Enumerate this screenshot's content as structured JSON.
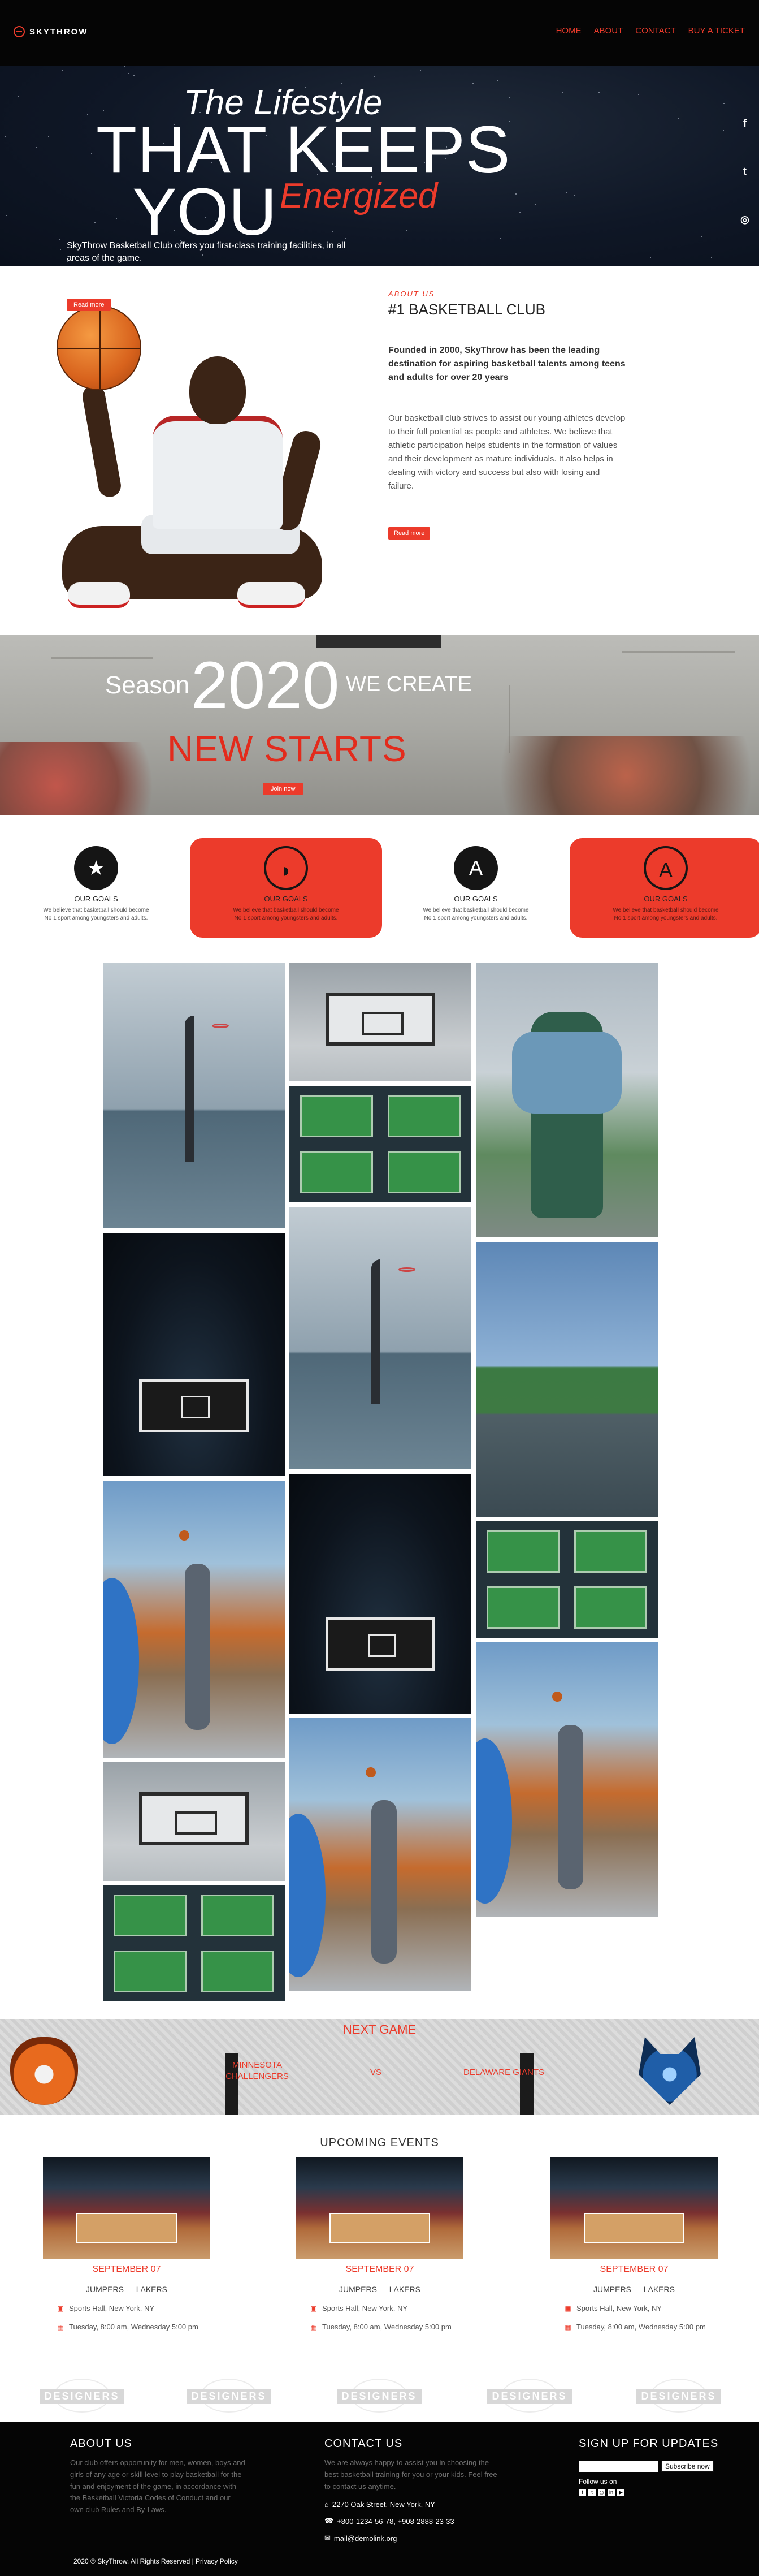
{
  "header": {
    "logo_text": "SKYTHROW",
    "nav": [
      "HOME",
      "ABOUT",
      "CONTACT",
      "BUY A TICKET"
    ]
  },
  "hero": {
    "line1": "The Lifestyle",
    "line2": "THAT KEEPS",
    "line3": "YOU",
    "line3_accent": "Energized",
    "subtitle": "SkyThrow Basketball Club offers you first-class training facilities, in all areas of the game.",
    "social_icons": [
      "facebook-icon",
      "twitter-icon",
      "instagram-icon"
    ],
    "social_glyphs": [
      "f",
      "t",
      "◎"
    ]
  },
  "about": {
    "read_more": "Read more",
    "kicker": "ABOUT US",
    "title": "#1 BASKETBALL CLUB",
    "bold_text": "Founded in 2000, SkyThrow has been the leading destination for aspiring basketball talents among teens and adults for over 20 years",
    "body_text": "Our basketball club strives to assist our young athletes develop to their full potential as people and athletes. We believe that athletic participation helps students in the formation of values and their development as mature individuals. It also helps in dealing with victory and success but also with losing and failure.",
    "button": "Read more"
  },
  "season": {
    "word": "Season",
    "year": "2020",
    "create": "WE CREATE",
    "new_starts": "NEW STARTS",
    "button": "Join now"
  },
  "goals": [
    {
      "title": "OUR GOALS",
      "text": "We believe that basketball should become No 1 sport among youngsters and adults.",
      "icon": "medal-icon",
      "glyph": "★"
    },
    {
      "title": "OUR GOALS",
      "text": "We believe that basketball should become No 1 sport among youngsters and adults.",
      "icon": "sneaker-icon",
      "glyph": "◗"
    },
    {
      "title": "OUR GOALS",
      "text": "We believe that basketball should become No 1 sport among youngsters and adults.",
      "icon": "emblem-icon",
      "glyph": "A"
    },
    {
      "title": "OUR GOALS",
      "text": "We believe that basketball should become No 1 sport among youngsters and adults.",
      "icon": "emblem-icon",
      "glyph": "A"
    }
  ],
  "next_game": {
    "title": "NEXT GAME",
    "home": "MINNESOTA CHALLENGERS",
    "vs": "VS",
    "away": "DELAWARE GIANTS"
  },
  "events": {
    "title": "UPCOMING EVENTS",
    "items": [
      {
        "date": "SEPTEMBER 07",
        "teams": "JUMPERS — LAKERS",
        "venue": "Sports Hall, New York, NY",
        "time": "Tuesday, 8:00 am, Wednesday 5:00 pm"
      },
      {
        "date": "SEPTEMBER 07",
        "teams": "JUMPERS — LAKERS",
        "venue": "Sports Hall, New York, NY",
        "time": "Tuesday, 8:00 am, Wednesday 5:00 pm"
      },
      {
        "date": "SEPTEMBER 07",
        "teams": "JUMPERS — LAKERS",
        "venue": "Sports Hall, New York, NY",
        "time": "Tuesday, 8:00 am, Wednesday 5:00 pm"
      }
    ]
  },
  "sponsors": [
    "DESIGNERS",
    "DESIGNERS",
    "DESIGNERS",
    "DESIGNERS",
    "DESIGNERS"
  ],
  "footer": {
    "about_title": "ABOUT US",
    "about_text": "Our club offers opportunity for men, women, boys and girls of any age or skill level to play basketball for the fun and enjoyment of the game, in accordance with the Basketball Victoria Codes of Conduct and our own club Rules and By-Laws.",
    "contact_title": "CONTACT US",
    "contact_text": "We are always happy to assist you in choosing the best basketball training for you or your kids. Feel free to contact us anytime.",
    "address": "2270 Oak Street, New York, NY",
    "phone": "+800-1234-56-78, +908-2888-23-33",
    "email": "mail@demolink.org",
    "signup_title": "SIGN UP FOR UPDATES",
    "subscribe_button": "Subscribe now",
    "follow": "Follow us on",
    "copyright": "2020 © SkyThrow. All Rights Reserved | Privacy Policy"
  }
}
